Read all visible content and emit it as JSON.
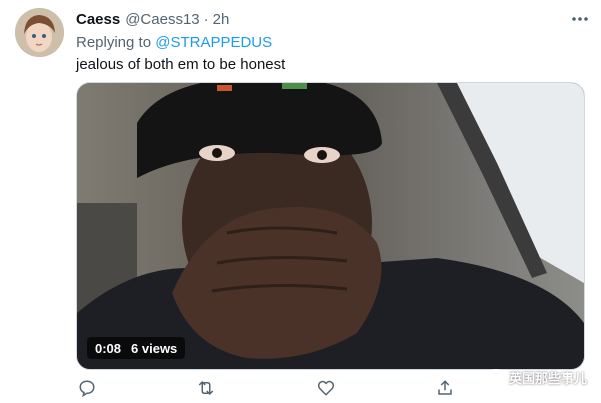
{
  "tweet": {
    "author_name": "Caess",
    "author_handle": "@Caess13",
    "separator": "·",
    "time": "2h",
    "reply_prefix": "Replying to",
    "reply_to": "@STRAPPEDUS",
    "text": "jealous of both em to be honest"
  },
  "media": {
    "duration": "0:08",
    "views": "6 views"
  },
  "actions": {
    "icons": [
      "reply-icon",
      "retweet-icon",
      "like-icon",
      "share-icon"
    ]
  },
  "watermark": {
    "text": "英国那些事儿"
  },
  "colors": {
    "accent": "#1d9bf0",
    "muted": "#536471",
    "text": "#0f1419"
  }
}
